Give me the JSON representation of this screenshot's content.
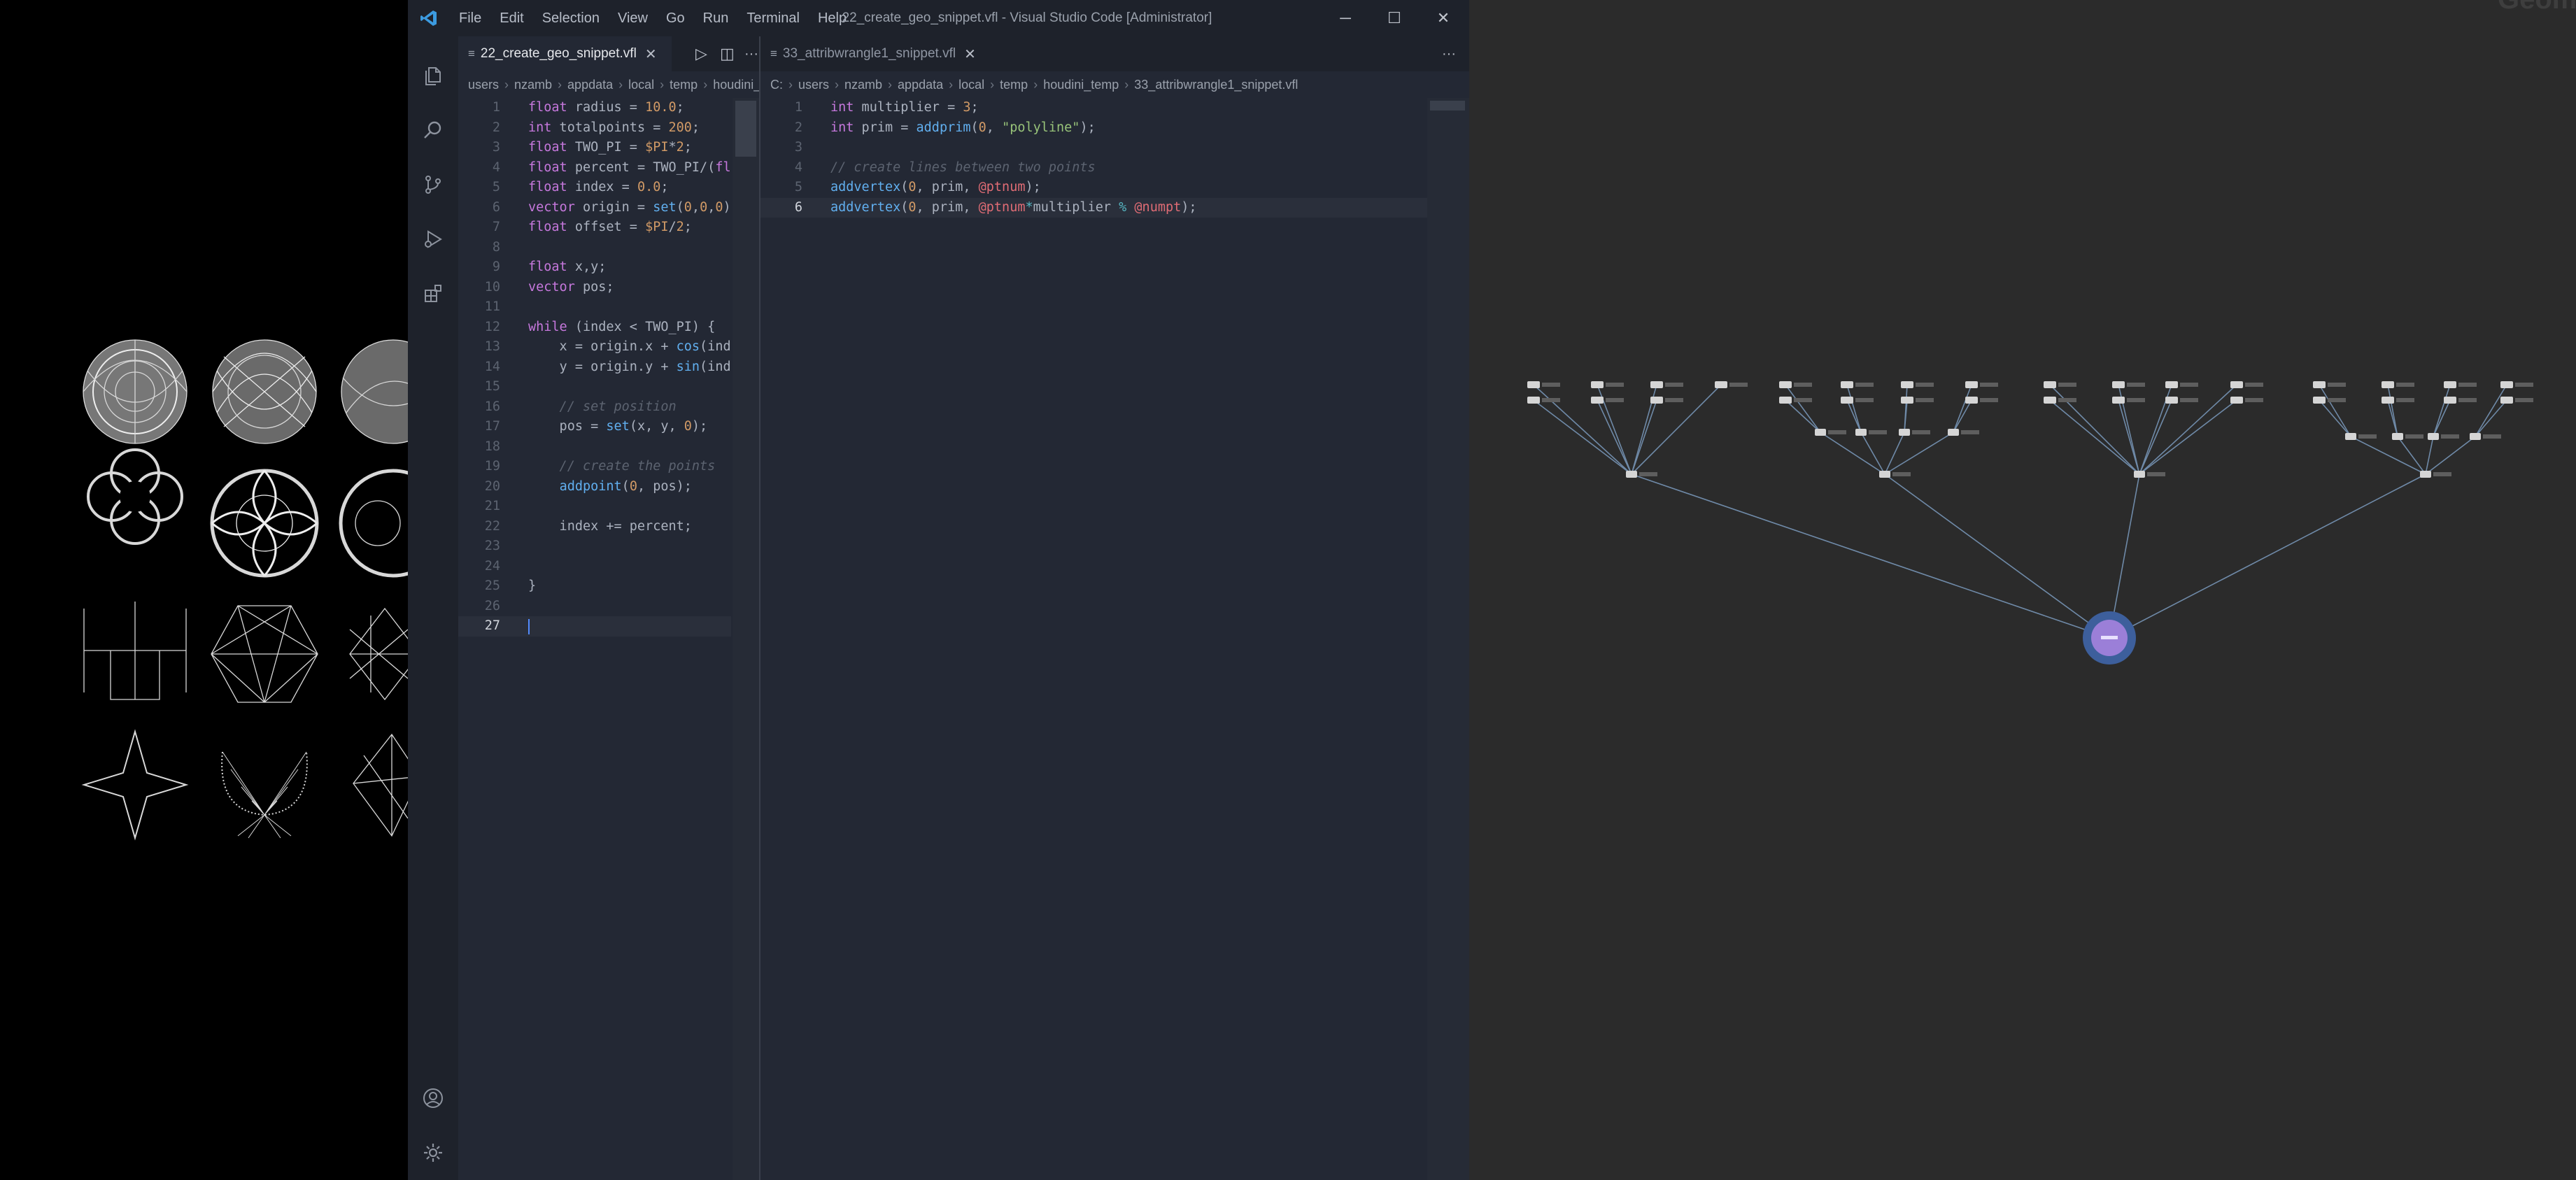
{
  "window": {
    "title": "22_create_geo_snippet.vfl - Visual Studio Code [Administrator]",
    "menu": [
      "File",
      "Edit",
      "Selection",
      "View",
      "Go",
      "Run",
      "Terminal",
      "Help"
    ],
    "controls": {
      "minimize": "─",
      "maximize": "☐",
      "close": "✕"
    }
  },
  "activity_bar": {
    "top": [
      "files-icon",
      "search-icon",
      "source-control-icon",
      "run-debug-icon",
      "extensions-icon"
    ],
    "bottom": [
      "account-icon",
      "settings-gear-icon"
    ]
  },
  "editor_left": {
    "tab": {
      "label": "22_create_geo_snippet.vfl",
      "close": "✕"
    },
    "toolbar": {
      "run": "▷",
      "split": "◫",
      "more": "···"
    },
    "breadcrumb": [
      "users",
      "nzamb",
      "appdata",
      "local",
      "temp",
      "houdini_ter"
    ],
    "lines": [
      [
        [
          "kw",
          "float"
        ],
        [
          "t",
          " radius = "
        ],
        [
          "num",
          "10.0"
        ],
        [
          "t",
          ";"
        ]
      ],
      [
        [
          "kw",
          "int"
        ],
        [
          "t",
          " totalpoints = "
        ],
        [
          "num",
          "200"
        ],
        [
          "t",
          ";"
        ]
      ],
      [
        [
          "kw",
          "float"
        ],
        [
          "t",
          " TWO_PI = "
        ],
        [
          "num",
          "$PI"
        ],
        [
          "t",
          "*"
        ],
        [
          "num",
          "2"
        ],
        [
          "t",
          ";"
        ]
      ],
      [
        [
          "kw",
          "float"
        ],
        [
          "t",
          " percent = TWO_PI/("
        ],
        [
          "kw",
          "float"
        ]
      ],
      [
        [
          "kw",
          "float"
        ],
        [
          "t",
          " index = "
        ],
        [
          "num",
          "0.0"
        ],
        [
          "t",
          ";"
        ]
      ],
      [
        [
          "kw",
          "vector"
        ],
        [
          "t",
          " origin = "
        ],
        [
          "fn",
          "set"
        ],
        [
          "t",
          "("
        ],
        [
          "num",
          "0"
        ],
        [
          "t",
          ","
        ],
        [
          "num",
          "0"
        ],
        [
          "t",
          ","
        ],
        [
          "num",
          "0"
        ],
        [
          "t",
          ");"
        ]
      ],
      [
        [
          "kw",
          "float"
        ],
        [
          "t",
          " offset = "
        ],
        [
          "num",
          "$PI"
        ],
        [
          "t",
          "/"
        ],
        [
          "num",
          "2"
        ],
        [
          "t",
          ";"
        ]
      ],
      [],
      [
        [
          "kw",
          "float"
        ],
        [
          "t",
          " x,y;"
        ]
      ],
      [
        [
          "kw",
          "vector"
        ],
        [
          "t",
          " pos;"
        ]
      ],
      [],
      [
        [
          "kw",
          "while"
        ],
        [
          "t",
          " (index < TWO_PI) {"
        ]
      ],
      [
        [
          "t",
          "    x = origin.x + "
        ],
        [
          "fn",
          "cos"
        ],
        [
          "t",
          "(index"
        ]
      ],
      [
        [
          "t",
          "    y = origin.y + "
        ],
        [
          "fn",
          "sin"
        ],
        [
          "t",
          "(index"
        ]
      ],
      [],
      [
        [
          "cm",
          "    // set position"
        ]
      ],
      [
        [
          "t",
          "    pos = "
        ],
        [
          "fn",
          "set"
        ],
        [
          "t",
          "(x, y, "
        ],
        [
          "num",
          "0"
        ],
        [
          "t",
          ");"
        ]
      ],
      [],
      [
        [
          "cm",
          "    // create the points"
        ]
      ],
      [
        [
          "t",
          "    "
        ],
        [
          "fn",
          "addpoint"
        ],
        [
          "t",
          "("
        ],
        [
          "num",
          "0"
        ],
        [
          "t",
          ", pos);"
        ]
      ],
      [],
      [
        [
          "t",
          "    index += percent;"
        ]
      ],
      [],
      [],
      [
        [
          "t",
          "}"
        ]
      ],
      [],
      [
        [
          "t",
          ""
        ]
      ]
    ]
  },
  "editor_right": {
    "tab": {
      "label": "33_attribwrangle1_snippet.vfl",
      "close": "✕"
    },
    "toolbar": {
      "more": "···"
    },
    "breadcrumb": [
      "C:",
      "users",
      "nzamb",
      "appdata",
      "local",
      "temp",
      "houdini_temp",
      "33_attribwrangle1_snippet.vfl"
    ],
    "lines": [
      [
        [
          "kw",
          "int"
        ],
        [
          "t",
          " multiplier = "
        ],
        [
          "num",
          "3"
        ],
        [
          "t",
          ";"
        ]
      ],
      [
        [
          "kw",
          "int"
        ],
        [
          "t",
          " prim = "
        ],
        [
          "fn",
          "addprim"
        ],
        [
          "t",
          "("
        ],
        [
          "num",
          "0"
        ],
        [
          "t",
          ", "
        ],
        [
          "str",
          "\"polyline\""
        ],
        [
          "t",
          ");"
        ]
      ],
      [],
      [
        [
          "cm",
          "// create lines between two points"
        ]
      ],
      [
        [
          "fn",
          "addvertex"
        ],
        [
          "t",
          "("
        ],
        [
          "num",
          "0"
        ],
        [
          "t",
          ", prim, "
        ],
        [
          "at",
          "@ptnum"
        ],
        [
          "t",
          ");"
        ]
      ],
      [
        [
          "fn",
          "addvertex"
        ],
        [
          "t",
          "("
        ],
        [
          "num",
          "0"
        ],
        [
          "t",
          ", prim, "
        ],
        [
          "at",
          "@ptnum"
        ],
        [
          "op",
          "*"
        ],
        [
          "t",
          "multiplier "
        ],
        [
          "op",
          "%"
        ],
        [
          "t",
          " "
        ],
        [
          "at",
          "@numpt"
        ],
        [
          "t",
          ");"
        ]
      ]
    ]
  },
  "network": {
    "corner_text": "Geom",
    "accent": "#9b7fd8"
  },
  "colors": {
    "keyword": "#c678dd",
    "number": "#d19a66",
    "function": "#61afef",
    "string": "#98c379",
    "comment": "#5c6370",
    "attribute": "#e06c75"
  }
}
